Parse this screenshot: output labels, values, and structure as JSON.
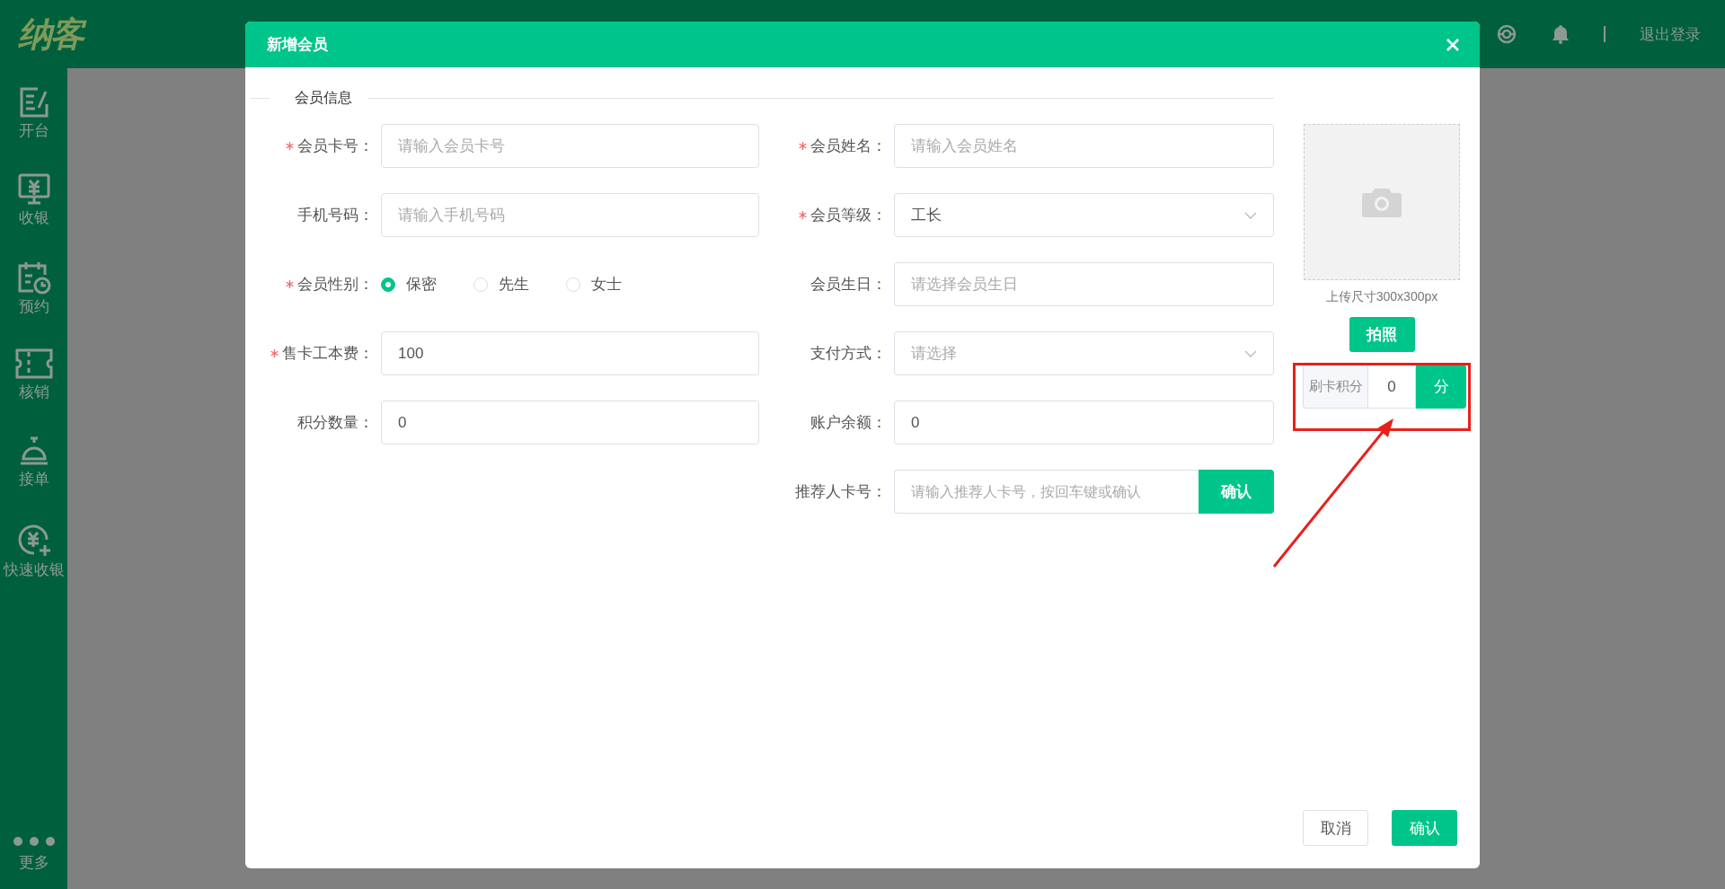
{
  "header": {
    "logo": "纳客",
    "logout": "退出登录"
  },
  "sidebar": {
    "items": [
      {
        "label": "开台",
        "kind": "edit"
      },
      {
        "label": "收银",
        "kind": "cashier"
      },
      {
        "label": "预约",
        "kind": "calendar"
      },
      {
        "label": "核销",
        "kind": "ticket"
      },
      {
        "label": "接单",
        "kind": "bell"
      },
      {
        "label": "快速收银",
        "kind": "quickpay"
      }
    ],
    "more": "更多"
  },
  "dialog": {
    "title": "新增会员",
    "section": "会员信息",
    "left_fields": [
      {
        "label": "会员卡号：",
        "required": true,
        "kind": "input",
        "placeholder": "请输入会员卡号"
      },
      {
        "label": "手机号码：",
        "required": false,
        "kind": "input",
        "placeholder": "请输入手机号码"
      },
      {
        "label": "会员性别：",
        "required": true,
        "kind": "radio",
        "options": [
          {
            "label": "保密",
            "selected": true
          },
          {
            "label": "先生",
            "selected": false
          },
          {
            "label": "女士",
            "selected": false
          }
        ]
      },
      {
        "label": "售卡工本费：",
        "required": true,
        "kind": "input",
        "value": "100"
      },
      {
        "label": "积分数量：",
        "required": false,
        "kind": "input",
        "value": "0"
      }
    ],
    "right_fields": [
      {
        "label": "会员姓名：",
        "required": true,
        "kind": "input",
        "placeholder": "请输入会员姓名"
      },
      {
        "label": "会员等级：",
        "required": true,
        "kind": "select",
        "value": "工长"
      },
      {
        "label": "会员生日：",
        "required": false,
        "kind": "input",
        "placeholder": "请选择会员生日"
      },
      {
        "label": "支付方式：",
        "required": false,
        "kind": "select",
        "placeholder": "请选择"
      },
      {
        "label": "账户余额：",
        "required": false,
        "kind": "input",
        "value": "0"
      },
      {
        "label": "推荐人卡号：",
        "required": false,
        "kind": "input_button",
        "placeholder": "请输入推荐人卡号，按回车键或确认",
        "button": "确认"
      }
    ],
    "photo": {
      "caption": "上传尺寸300x300px",
      "button": "拍照"
    },
    "points": {
      "label": "刷卡积分",
      "value": "0",
      "unit": "分"
    },
    "buttons": [
      {
        "label": "取消",
        "kind": "default"
      },
      {
        "label": "确认",
        "kind": "primary"
      }
    ]
  }
}
